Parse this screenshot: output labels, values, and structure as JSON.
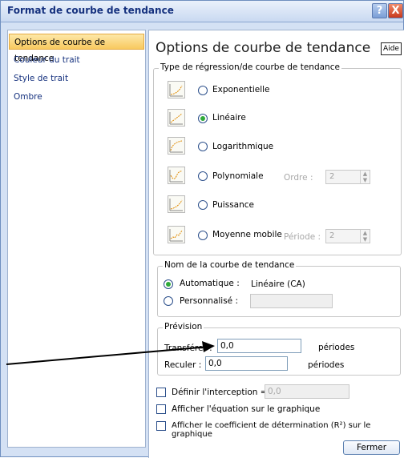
{
  "window": {
    "title": "Format de courbe de tendance",
    "help_btn": "?",
    "close_btn": "X"
  },
  "nav": {
    "items": [
      "Options de courbe de tendance",
      "Couleur du trait",
      "Style de trait",
      "Ombre"
    ],
    "selected": 0
  },
  "main": {
    "heading": "Options de courbe de tendance",
    "aide": "Aide",
    "regression": {
      "label": "Type de régression/de courbe de tendance",
      "options": [
        {
          "label": "Exponentielle",
          "selected": false
        },
        {
          "label": "Linéaire",
          "selected": true
        },
        {
          "label": "Logarithmique",
          "selected": false
        },
        {
          "label": "Polynomiale",
          "selected": false
        },
        {
          "label": "Puissance",
          "selected": false
        },
        {
          "label": "Moyenne mobile",
          "selected": false
        }
      ],
      "ordre_label": "Ordre :",
      "ordre_value": "2",
      "periode_label": "Période :",
      "periode_value": "2"
    },
    "name_group": {
      "label": "Nom de la courbe de tendance",
      "auto_label": "Automatique :",
      "auto_value": "Linéaire (CA)",
      "custom_label": "Personnalisé :",
      "custom_value": ""
    },
    "forecast": {
      "label": "Prévision",
      "forward_label": "Transférer :",
      "forward_value": "0,0",
      "forward_unit": "périodes",
      "backward_label": "Reculer :",
      "backward_value": "0,0",
      "backward_unit": "périodes"
    },
    "checkboxes": {
      "intercept_label": "Définir l'interception =",
      "intercept_value": "0,0",
      "equation_label": "Afficher l'équation sur le graphique",
      "r2_label": "Afficher le coefficient de détermination (R²) sur le graphique"
    },
    "close_button": "Fermer"
  },
  "colors": {
    "accent": "#15317e",
    "selected_nav": "#f8c95f",
    "radio_on": "#2faa3a"
  }
}
